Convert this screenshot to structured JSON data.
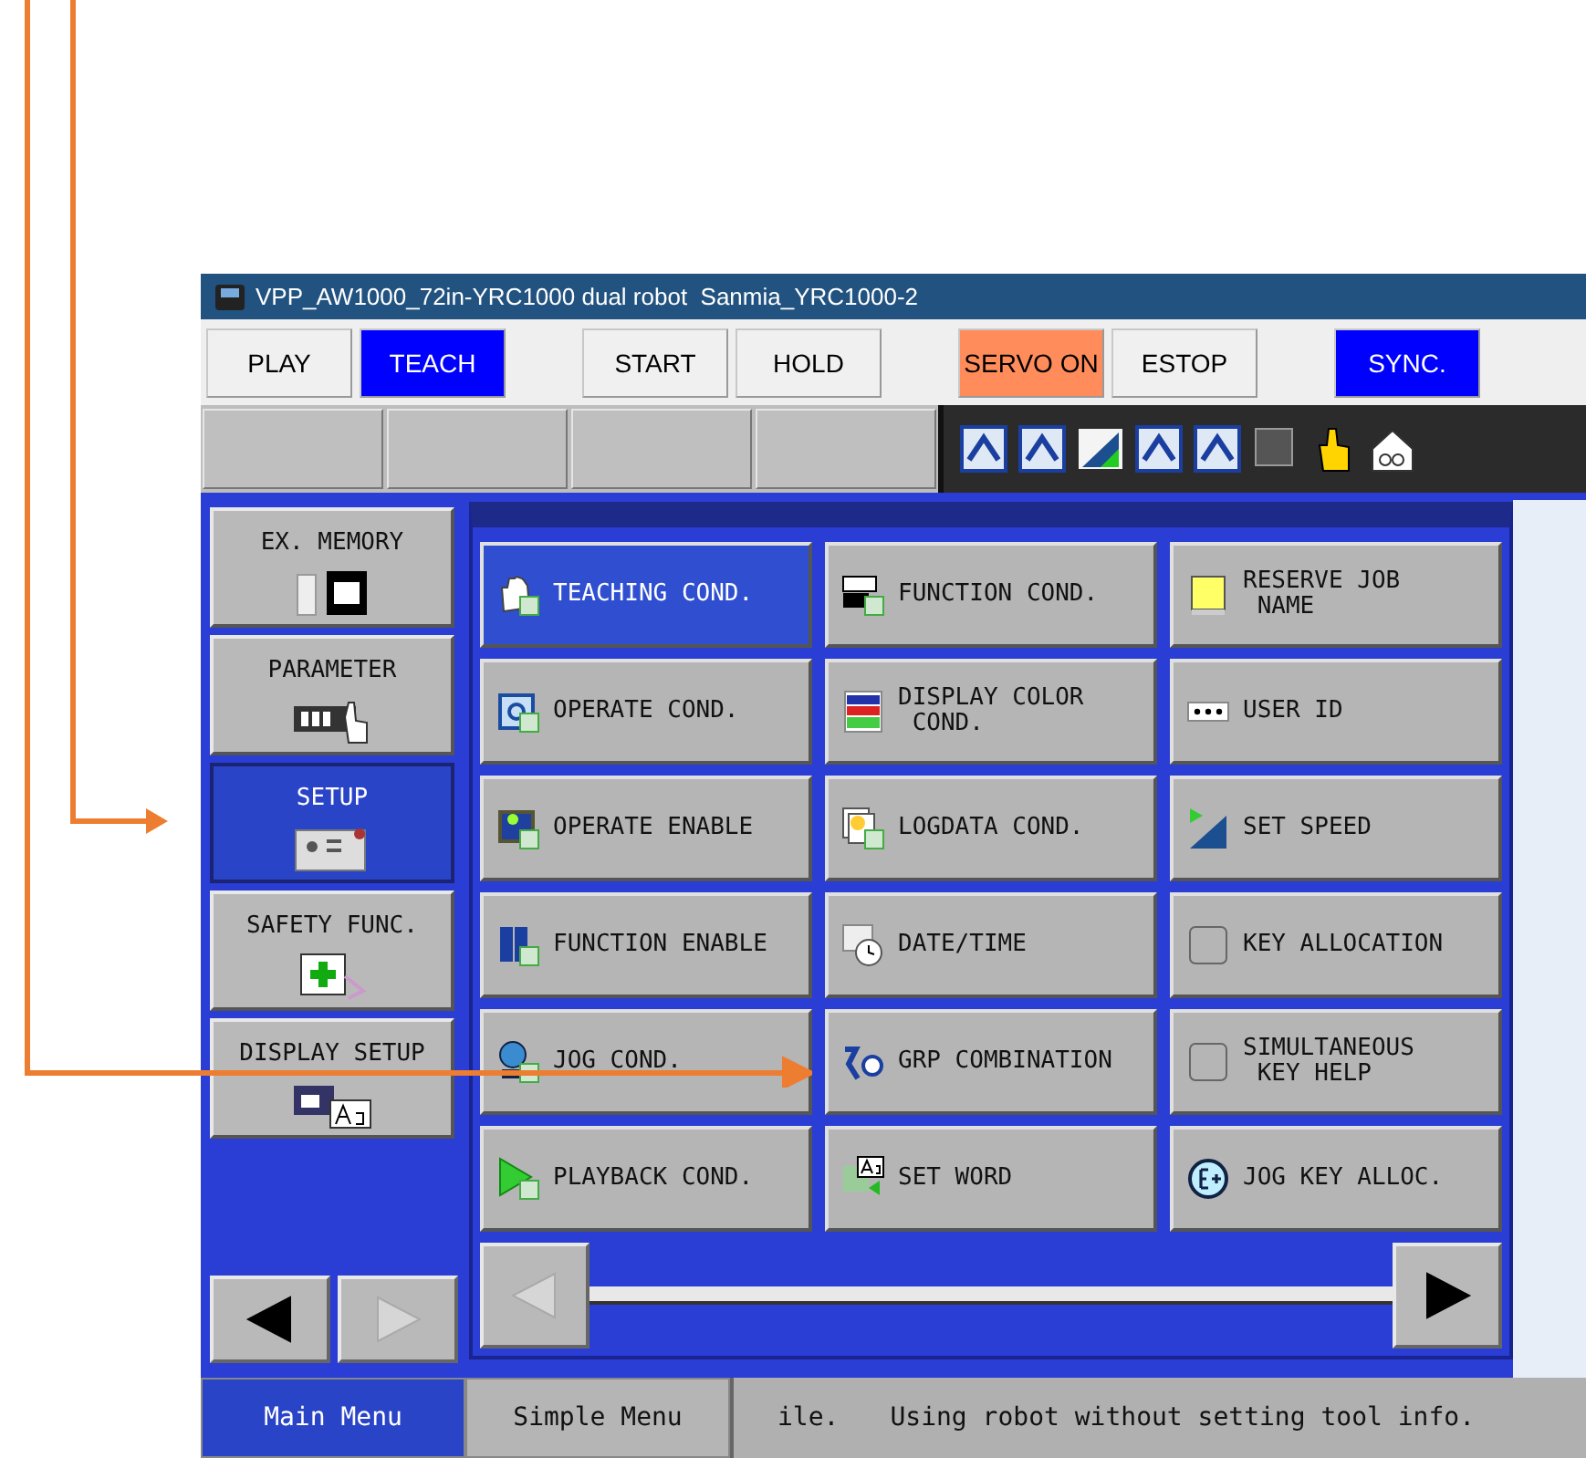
{
  "window": {
    "title": "VPP_AW1000_72in-YRC1000 dual robot  Sanmia_YRC1000-2"
  },
  "toolbar": {
    "groups": [
      {
        "buttons": [
          {
            "label": "PLAY",
            "on": false
          },
          {
            "label": "TEACH",
            "on": true,
            "color": "#0000ff"
          }
        ]
      },
      {
        "buttons": [
          {
            "label": "START",
            "on": false
          },
          {
            "label": "HOLD",
            "on": false
          }
        ]
      },
      {
        "buttons": [
          {
            "label": "SERVO ON",
            "on": true,
            "color": "#ff8c5a"
          },
          {
            "label": "ESTOP",
            "on": false
          }
        ]
      },
      {
        "buttons": [
          {
            "label": "SYNC.",
            "on": true,
            "color": "#0000ff"
          }
        ]
      }
    ]
  },
  "sidebar": {
    "items": [
      {
        "label": "EX. MEMORY",
        "selected": false
      },
      {
        "label": "PARAMETER",
        "selected": false
      },
      {
        "label": "SETUP",
        "selected": true
      },
      {
        "label": "SAFETY FUNC.",
        "selected": false
      },
      {
        "label": "DISPLAY SETUP",
        "selected": false
      }
    ],
    "prev_disabled": false,
    "next_disabled": true
  },
  "menu": {
    "items": [
      {
        "label": "TEACHING COND.",
        "selected": true
      },
      {
        "label": "FUNCTION COND.",
        "selected": false
      },
      {
        "label": "RESERVE JOB\n NAME",
        "selected": false
      },
      {
        "label": "OPERATE COND.",
        "selected": false
      },
      {
        "label": "DISPLAY COLOR\n COND.",
        "selected": false
      },
      {
        "label": "USER ID",
        "selected": false
      },
      {
        "label": "OPERATE ENABLE",
        "selected": false
      },
      {
        "label": "LOGDATA COND.",
        "selected": false
      },
      {
        "label": "SET SPEED",
        "selected": false
      },
      {
        "label": "FUNCTION ENABLE",
        "selected": false
      },
      {
        "label": "DATE/TIME",
        "selected": false
      },
      {
        "label": "KEY ALLOCATION",
        "selected": false
      },
      {
        "label": "JOG COND.",
        "selected": false
      },
      {
        "label": "GRP COMBINATION",
        "selected": false
      },
      {
        "label": "SIMULTANEOUS\n KEY HELP",
        "selected": false
      },
      {
        "label": "PLAYBACK COND.",
        "selected": false
      },
      {
        "label": "SET WORD",
        "selected": false
      },
      {
        "label": "JOG KEY ALLOC.",
        "selected": false
      }
    ],
    "prev_disabled": true,
    "next_disabled": false
  },
  "status_bar": {
    "tabs": [
      {
        "label": "Main Menu",
        "selected": true
      },
      {
        "label": "Simple Menu",
        "selected": false
      }
    ],
    "messages": [
      "ile.",
      "Using robot without setting tool info."
    ]
  }
}
